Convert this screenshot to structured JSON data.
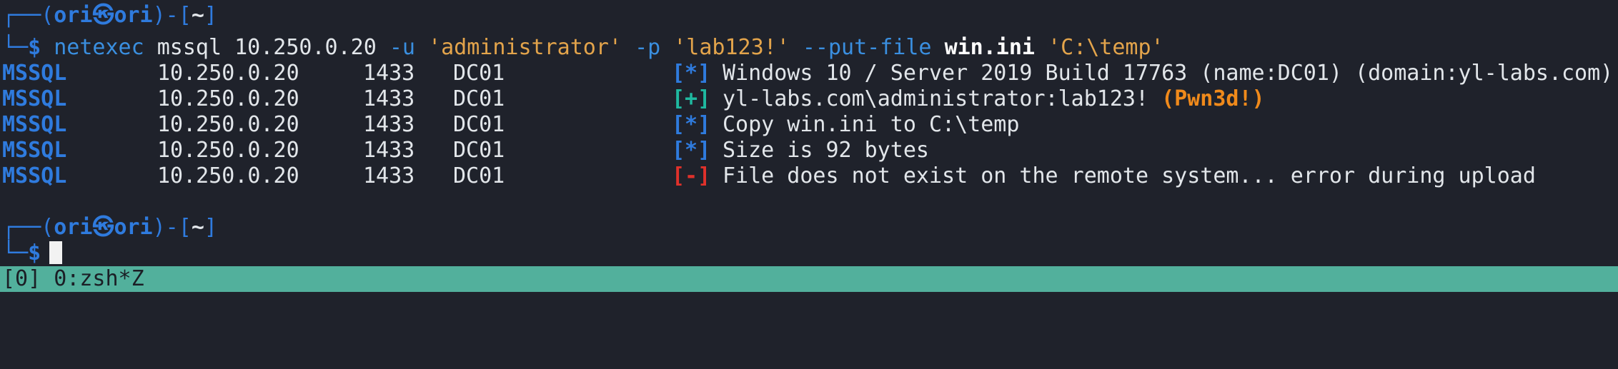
{
  "prompt": {
    "corner_top": "┌──",
    "corner_bottom": "└─",
    "user": "ori",
    "at_symbol": "㉿",
    "host": "ori",
    "dir": "~",
    "dollar": "$"
  },
  "command": {
    "bin": "netexec",
    "proto": "mssql",
    "target": "10.250.0.20",
    "flag_user": "-u",
    "user": "'administrator'",
    "flag_pass": "-p",
    "pass": "'lab123!'",
    "flag_put": "--put-file",
    "file": "win.ini",
    "dest": "'C:\\temp'"
  },
  "output_rows": [
    {
      "proto": "MSSQL",
      "ip": "10.250.0.20",
      "port": "1433",
      "host": "DC01",
      "marker": "[*]",
      "status": "info",
      "message": "Windows 10 / Server 2019 Build 17763 (name:DC01) (domain:yl-labs.com)",
      "extra": ""
    },
    {
      "proto": "MSSQL",
      "ip": "10.250.0.20",
      "port": "1433",
      "host": "DC01",
      "marker": "[+]",
      "status": "success",
      "message": "yl-labs.com\\administrator:lab123! ",
      "extra": "(Pwn3d!)"
    },
    {
      "proto": "MSSQL",
      "ip": "10.250.0.20",
      "port": "1433",
      "host": "DC01",
      "marker": "[*]",
      "status": "info",
      "message": "Copy win.ini to C:\\temp",
      "extra": ""
    },
    {
      "proto": "MSSQL",
      "ip": "10.250.0.20",
      "port": "1433",
      "host": "DC01",
      "marker": "[*]",
      "status": "info",
      "message": "Size is 92 bytes",
      "extra": ""
    },
    {
      "proto": "MSSQL",
      "ip": "10.250.0.20",
      "port": "1433",
      "host": "DC01",
      "marker": "[-]",
      "status": "error",
      "message": "File does not exist on the remote system... error during upload",
      "extra": ""
    }
  ],
  "statusbar": {
    "text": "[0] 0:zsh*Z"
  },
  "colors": {
    "background": "#1f222b",
    "prompt_blue": "#2f7bde",
    "string_orange": "#e3a44b",
    "success_green": "#1fb9a0",
    "error_red": "#e0312b",
    "pwned_orange": "#f08a1b",
    "statusbar_bg": "#52b09c"
  }
}
